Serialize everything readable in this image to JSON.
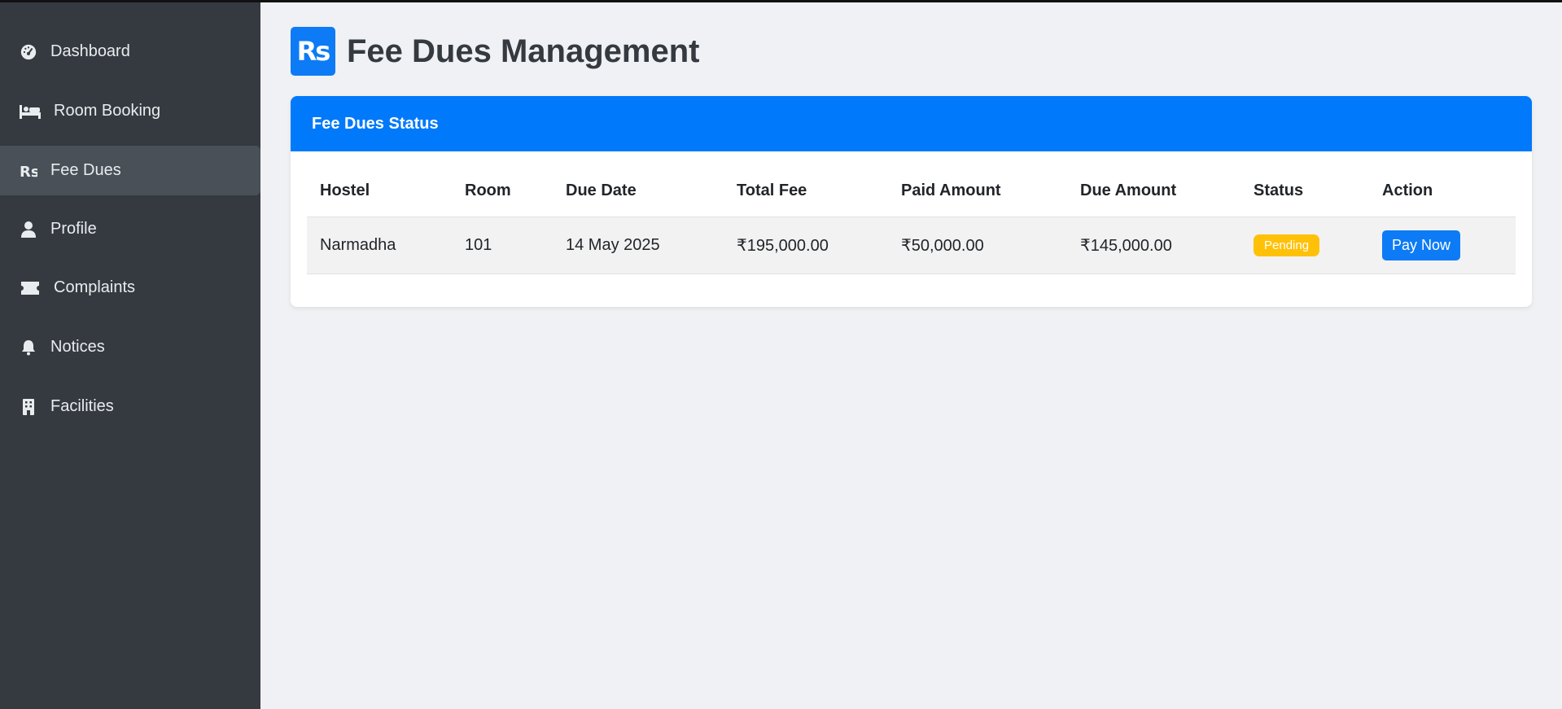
{
  "sidebar": {
    "items": [
      {
        "label": "Dashboard",
        "icon": "dashboard-icon"
      },
      {
        "label": "Room Booking",
        "icon": "bed-icon"
      },
      {
        "label": "Fee Dues",
        "icon": "rupee-icon",
        "active": true
      },
      {
        "label": "Profile",
        "icon": "user-icon"
      },
      {
        "label": "Complaints",
        "icon": "ticket-icon"
      },
      {
        "label": "Notices",
        "icon": "bell-icon"
      },
      {
        "label": "Facilities",
        "icon": "building-icon"
      }
    ]
  },
  "header": {
    "logo_text": "Rs",
    "title": "Fee Dues Management"
  },
  "card": {
    "title": "Fee Dues Status"
  },
  "table": {
    "columns": [
      "Hostel",
      "Room",
      "Due Date",
      "Total Fee",
      "Paid Amount",
      "Due Amount",
      "Status",
      "Action"
    ],
    "rows": [
      {
        "hostel": "Narmadha",
        "room": "101",
        "due_date": "14 May 2025",
        "total_fee": "₹195,000.00",
        "paid_amount": "₹50,000.00",
        "due_amount": "₹145,000.00",
        "status": "Pending",
        "action": "Pay Now"
      }
    ]
  },
  "colors": {
    "sidebar_bg": "#343a40",
    "active_item_bg": "#495057",
    "primary": "#0079fb",
    "pending_badge": "#ffc107",
    "page_bg": "#f0f1f4"
  }
}
